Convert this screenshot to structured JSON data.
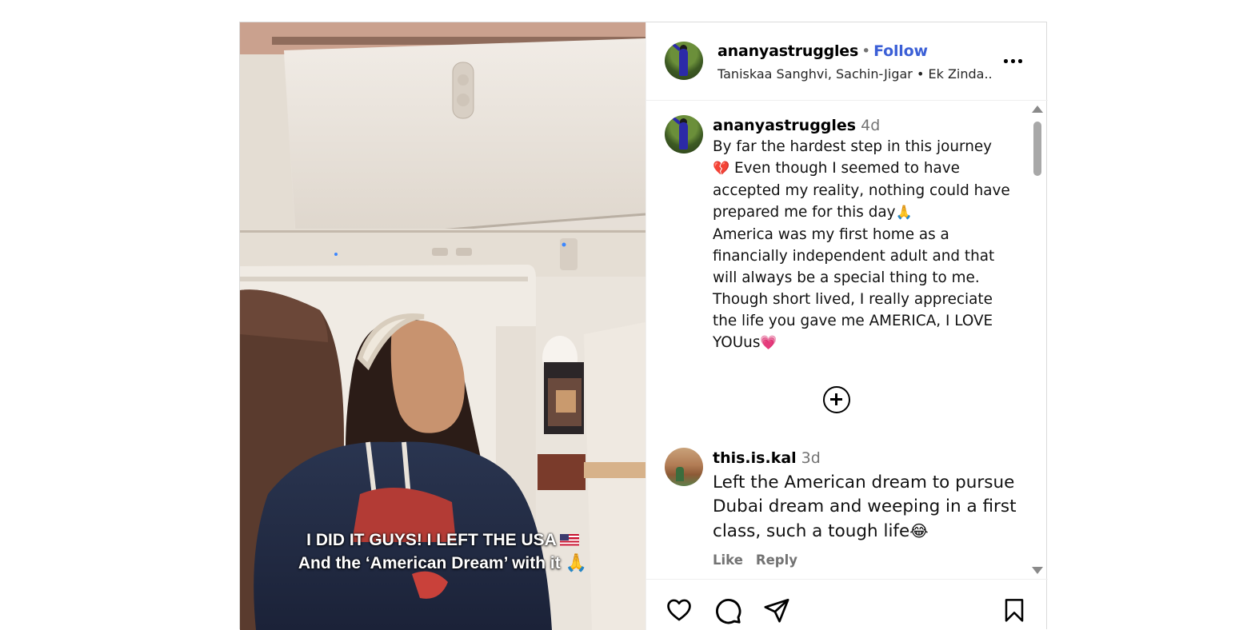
{
  "post": {
    "overlay_line1": "I DID IT GUYS! I LEFT THE USA",
    "overlay_line2": "And the ‘American Dream’ with it"
  },
  "header": {
    "username": "ananyastruggles",
    "separator": "•",
    "follow_label": "Follow",
    "audio": "Taniskaa Sanghvi, Sachin-Jigar • Ek Zinda..."
  },
  "caption": {
    "username": "ananyastruggles",
    "time": "4d",
    "line1": "By far the hardest step in this journey",
    "line2a": "💔",
    "line2b": " Even though I seemed to have",
    "line3": "accepted my reality, nothing could have",
    "line4": "prepared me for this day",
    "line4_emoji": "🙏",
    "line5": "America was my first home as a",
    "line6": "financially independent adult and that",
    "line7": "will always be a special thing to me.",
    "line8": "Though short lived, I really appreciate",
    "line9": "the life you gave me AMERICA, I LOVE",
    "line10": "YOUus",
    "line10_emoji": "💗"
  },
  "comments": [
    {
      "username": "this.is.kal",
      "time": "3d",
      "text_line1": "Left the American dream to pursue",
      "text_line2": "Dubai dream and weeping in a first",
      "text_line3": "class, such a tough life",
      "emoji": "😂",
      "like_label": "Like",
      "reply_label": "Reply"
    }
  ],
  "icons": {
    "like": "heart-icon",
    "comment": "comment-bubble-icon",
    "share": "paper-plane-icon",
    "save": "bookmark-icon",
    "more": "more-options-icon",
    "load_more": "plus-circle-icon"
  }
}
